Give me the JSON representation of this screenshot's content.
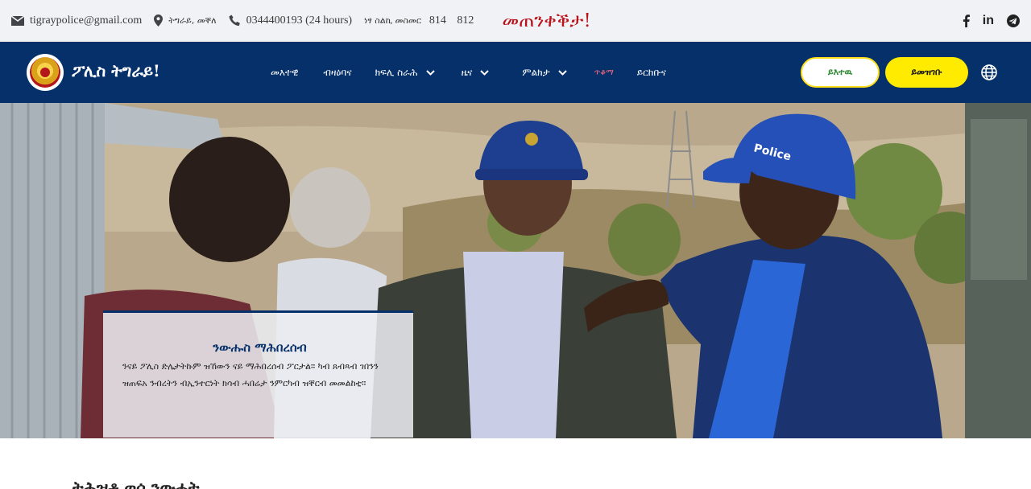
{
  "topbar": {
    "email": "tigraypolice@gmail.com",
    "location": "ትግራይ, መቐለ",
    "phone": "0344400193 (24 hours)",
    "toll_free_label": "ነፃ ስልኪ መስመር",
    "toll_free_numbers": [
      "814",
      "812"
    ],
    "slogan": "መጠንቀቕታ!",
    "social": [
      {
        "name": "facebook",
        "label": "f"
      },
      {
        "name": "linkedin",
        "label": "in"
      },
      {
        "name": "telegram",
        "label": ""
      }
    ]
  },
  "navbar": {
    "brand": "ፖሊስ ትግራይ!",
    "menu": [
      {
        "label": "መእተዊ",
        "dropdown": false,
        "active": false
      },
      {
        "label": "ብዛዕባና",
        "dropdown": false,
        "active": false
      },
      {
        "label": "ክፍሊ ስራሕ",
        "dropdown": true,
        "active": false
      },
      {
        "label": "ዜና",
        "dropdown": true,
        "active": false
      },
      {
        "label": "ምልክታ",
        "dropdown": true,
        "active": false
      },
      {
        "label": "ጥቆማ",
        "dropdown": false,
        "active": true
      },
      {
        "label": "ይርከቡና",
        "dropdown": false,
        "active": false
      }
    ],
    "login_label": "ይእተዉ",
    "register_label": "ይመዝገቡ",
    "globe_icon": "globe-icon"
  },
  "hero": {
    "caption_title": "ንውሑስ ማሕበረሰብ",
    "caption_text": "ንናይ ፖሊስ ድሌታትኩም ዝኸውን ናይ ማሕበረሰብ ፖርታል። ካብ ጸብጻብ ገበንን ዝጠፍአ ንብረትን ብኢንተርነት ክሳብ ሓበሬታ ንምርካብ ዝቐርብ መመልከቲ።"
  },
  "section": {
    "heading": "ትሕዝቶ ወሳ ንውሓት"
  },
  "colors": {
    "navbar_bg": "#05306a",
    "slogan": "#b8131b",
    "active_menu": "#ff6b7d",
    "register_bg": "#ffeb00",
    "login_text": "#2f8a34"
  }
}
